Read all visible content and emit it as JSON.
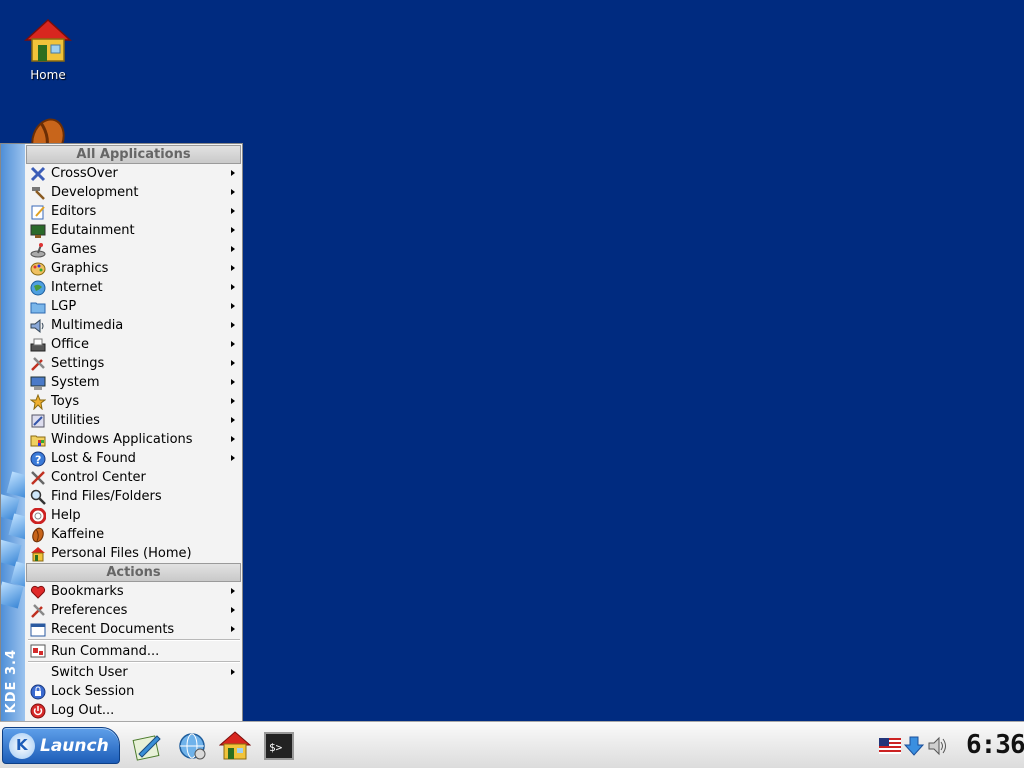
{
  "desktop": {
    "icons": [
      {
        "label": "Home",
        "icon": "home-icon"
      },
      {
        "label": "",
        "icon": "kaffeine-icon"
      }
    ]
  },
  "kmenu": {
    "side_label": "KDE 3.4",
    "sections": {
      "all_applications": "All Applications",
      "actions": "Actions"
    },
    "app_items": [
      {
        "label": "CrossOver",
        "icon": "crossover-icon",
        "submenu": true
      },
      {
        "label": "Development",
        "icon": "hammer-icon",
        "submenu": true
      },
      {
        "label": "Editors",
        "icon": "editor-icon",
        "submenu": true
      },
      {
        "label": "Edutainment",
        "icon": "edutainment-icon",
        "submenu": true
      },
      {
        "label": "Games",
        "icon": "joystick-icon",
        "submenu": true
      },
      {
        "label": "Graphics",
        "icon": "palette-icon",
        "submenu": true
      },
      {
        "label": "Internet",
        "icon": "globe-icon",
        "submenu": true
      },
      {
        "label": "LGP",
        "icon": "folder-icon",
        "submenu": true
      },
      {
        "label": "Multimedia",
        "icon": "speaker-icon",
        "submenu": true
      },
      {
        "label": "Office",
        "icon": "typewriter-icon",
        "submenu": true
      },
      {
        "label": "Settings",
        "icon": "tools-icon",
        "submenu": true
      },
      {
        "label": "System",
        "icon": "computer-icon",
        "submenu": true
      },
      {
        "label": "Toys",
        "icon": "toys-icon",
        "submenu": true
      },
      {
        "label": "Utilities",
        "icon": "utilities-icon",
        "submenu": true
      },
      {
        "label": "Windows Applications",
        "icon": "windows-folder-icon",
        "submenu": true
      },
      {
        "label": "Lost & Found",
        "icon": "help-circle-icon",
        "submenu": true
      },
      {
        "label": "Control Center",
        "icon": "wrench-screwdriver-icon",
        "submenu": false
      },
      {
        "label": "Find Files/Folders",
        "icon": "magnifier-icon",
        "submenu": false
      },
      {
        "label": "Help",
        "icon": "lifebuoy-icon",
        "submenu": false
      },
      {
        "label": "Kaffeine",
        "icon": "kaffeine-icon",
        "submenu": false
      },
      {
        "label": "Personal Files (Home)",
        "icon": "home-icon",
        "submenu": false
      }
    ],
    "action_items": [
      {
        "label": "Bookmarks",
        "icon": "heart-icon",
        "submenu": true
      },
      {
        "label": "Preferences",
        "icon": "tools-icon",
        "submenu": true
      },
      {
        "label": "Recent Documents",
        "icon": "document-window-icon",
        "submenu": true
      }
    ],
    "run_command": {
      "label": "Run Command...",
      "icon": "run-icon"
    },
    "session_items": [
      {
        "label": "Switch User",
        "icon": "",
        "submenu": true
      },
      {
        "label": "Lock Session",
        "icon": "lock-icon",
        "submenu": false
      },
      {
        "label": "Log Out...",
        "icon": "power-icon",
        "submenu": false
      }
    ]
  },
  "taskbar": {
    "launch_label": "Launch",
    "quicklaunch": [
      {
        "icon": "editor-pen-icon"
      },
      {
        "icon": "konqueror-globe-icon"
      },
      {
        "icon": "home-icon"
      },
      {
        "icon": "terminal-icon"
      }
    ],
    "tray": [
      {
        "icon": "us-flag-icon"
      },
      {
        "icon": "download-arrow-icon"
      },
      {
        "icon": "volume-icon"
      }
    ],
    "clock": "6:36"
  },
  "colors": {
    "desktop_bg": "#002b80",
    "menu_bg": "#f3f3f3",
    "launch_blue": "#1d5db8"
  }
}
